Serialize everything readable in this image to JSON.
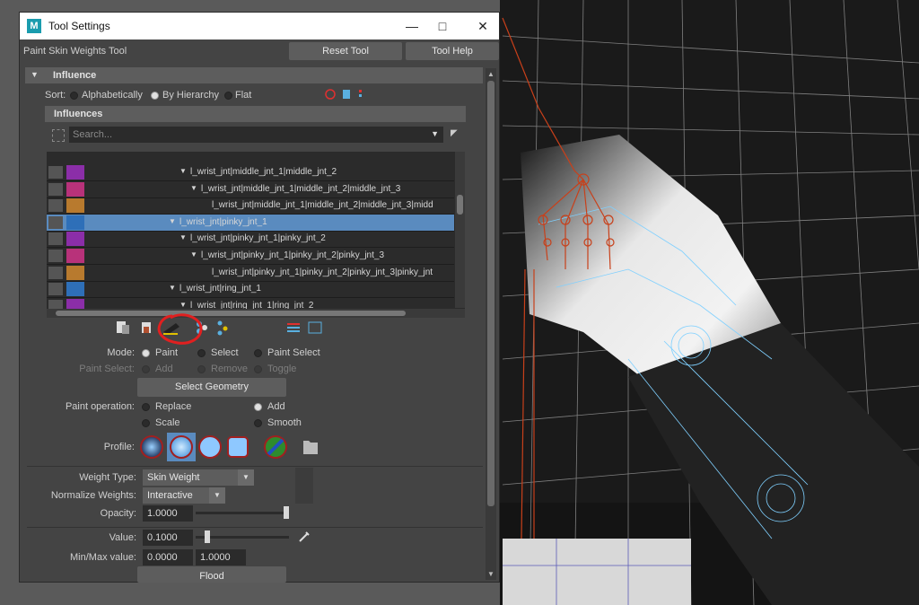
{
  "window": {
    "title": "Tool Settings",
    "tool_name": "Paint Skin Weights Tool",
    "reset_tool": "Reset Tool",
    "tool_help": "Tool Help"
  },
  "influence": {
    "section_title": "Influence",
    "sort_label": "Sort:",
    "sort_options": [
      "Alphabetically",
      "By Hierarchy",
      "Flat"
    ],
    "sort_selected": "By Hierarchy",
    "influences_header": "Influences",
    "search_placeholder": "Search...",
    "rows": [
      {
        "label": "l_wrist_jnt|middle_jnt_1|middle_jnt_2",
        "color": "#8b2ea8",
        "indent": 1,
        "expanded": true,
        "selected": false
      },
      {
        "label": "l_wrist_jnt|middle_jnt_1|middle_jnt_2|middle_jnt_3",
        "color": "#b8327a",
        "indent": 2,
        "expanded": true,
        "selected": false
      },
      {
        "label": "l_wrist_jnt|middle_jnt_1|middle_jnt_2|middle_jnt_3|midd",
        "color": "#b87a2e",
        "indent": 3,
        "expanded": false,
        "selected": false
      },
      {
        "label": "l_wrist_jnt|pinky_jnt_1",
        "color": "#2e6fb8",
        "indent": 0,
        "expanded": true,
        "selected": true
      },
      {
        "label": "l_wrist_jnt|pinky_jnt_1|pinky_jnt_2",
        "color": "#8b2ea8",
        "indent": 1,
        "expanded": true,
        "selected": false
      },
      {
        "label": "l_wrist_jnt|pinky_jnt_1|pinky_jnt_2|pinky_jnt_3",
        "color": "#b8327a",
        "indent": 2,
        "expanded": true,
        "selected": false
      },
      {
        "label": "l_wrist_jnt|pinky_jnt_1|pinky_jnt_2|pinky_jnt_3|pinky_jnt",
        "color": "#b87a2e",
        "indent": 3,
        "expanded": false,
        "selected": false
      },
      {
        "label": "l_wrist_jnt|ring_jnt_1",
        "color": "#2e6fb8",
        "indent": 0,
        "expanded": true,
        "selected": false
      },
      {
        "label": "l_wrist_jnt|ring_jnt_1|ring_jnt_2",
        "color": "#8b2ea8",
        "indent": 1,
        "expanded": true,
        "selected": false
      }
    ]
  },
  "mode": {
    "label": "Mode:",
    "options": [
      "Paint",
      "Select",
      "Paint Select"
    ],
    "selected": "Paint"
  },
  "paint_select": {
    "label": "Paint Select:",
    "options": [
      "Add",
      "Remove",
      "Toggle"
    ]
  },
  "select_geometry": "Select Geometry",
  "paint_operation": {
    "label": "Paint operation:",
    "options": [
      "Replace",
      "Add",
      "Scale",
      "Smooth"
    ],
    "selected": "Add"
  },
  "profile": {
    "label": "Profile:",
    "icons": [
      "gaussian-brush-icon",
      "soft-brush-icon",
      "solid-brush-icon",
      "square-brush-icon",
      "image-brush-icon",
      "folder-icon"
    ],
    "selected_index": 1
  },
  "weight_type": {
    "label": "Weight Type:",
    "value": "Skin Weight"
  },
  "normalize_weights": {
    "label": "Normalize Weights:",
    "value": "Interactive"
  },
  "opacity": {
    "label": "Opacity:",
    "value": "1.0000",
    "level": 1.0
  },
  "value": {
    "label": "Value:",
    "value": "0.1000",
    "level": 0.1
  },
  "minmax": {
    "label": "Min/Max value:",
    "min": "0.0000",
    "max": "1.0000"
  },
  "flood": "Flood",
  "colors": {
    "panel_bg": "#444444",
    "button_bg": "#5d5d5d",
    "field_bg": "#2b2b2b",
    "selection": "#5a8bbf",
    "annotation_red": "#e02020",
    "wire_cyan": "#7fd0ff",
    "joint_orange": "#c8401a"
  }
}
